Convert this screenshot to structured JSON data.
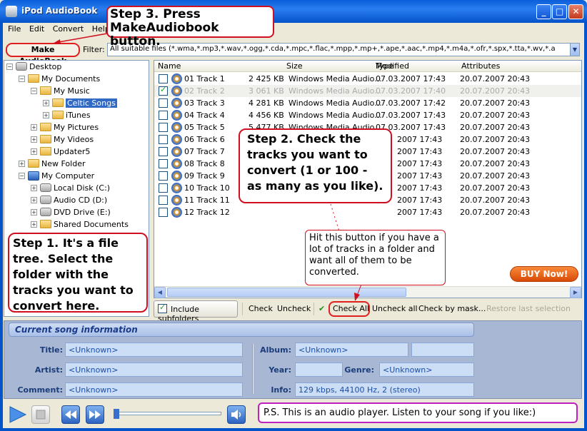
{
  "window": {
    "title": "iPod AudioBook",
    "buttons": {
      "minimize": "_",
      "maximize": "□",
      "close": "✕"
    }
  },
  "menu": [
    "File",
    "Edit",
    "Convert",
    "Help"
  ],
  "toolbar": {
    "make_button": "Make AudioBook",
    "filter_label": "Filter:",
    "filter_value": "All suitable files (*.wma,*.mp3,*.wav,*.ogg,*.cda,*.mpc,*.flac,*.mpp,*.mp+,*.ape,*.aac,*.mp4,*.m4a,*.ofr,*.spx,*.tta,*.wv,*.a"
  },
  "tree": {
    "desktop": "Desktop",
    "my_documents": "My Documents",
    "my_music": "My Music",
    "celtic_songs": "Celtic Songs",
    "itunes": "iTunes",
    "my_pictures": "My Pictures",
    "my_videos": "My Videos",
    "updater5": "Updater5",
    "new_folder": "New Folder",
    "my_computer": "My Computer",
    "local_disk": "Local Disk (C:)",
    "audio_cd": "Audio CD (D:)",
    "dvd_drive": "DVD Drive (E:)",
    "shared_documents": "Shared Documents"
  },
  "list": {
    "columns": [
      "Name",
      "Size",
      "Type",
      "Modified",
      "Attributes"
    ],
    "rows": [
      {
        "name": "01 Track 1",
        "size": "2 425 KB",
        "type": "Windows Media Audio...",
        "modified": "07.03.2007 17:43",
        "attributes": "20.07.2007 20:43",
        "checked": false
      },
      {
        "name": "02 Track 2",
        "size": "3 061 KB",
        "type": "Windows Media Audio...",
        "modified": "07.03.2007 17:40",
        "attributes": "20.07.2007 20:43",
        "checked": true
      },
      {
        "name": "03 Track 3",
        "size": "4 281 KB",
        "type": "Windows Media Audio...",
        "modified": "07.03.2007 17:42",
        "attributes": "20.07.2007 20:43",
        "checked": false
      },
      {
        "name": "04 Track 4",
        "size": "4 456 KB",
        "type": "Windows Media Audio...",
        "modified": "07.03.2007 17:43",
        "attributes": "20.07.2007 20:43",
        "checked": false
      },
      {
        "name": "05 Track 5",
        "size": "5 477 KB",
        "type": "Windows Media Audio...",
        "modified": "07.03.2007 17:43",
        "attributes": "20.07.2007 20:43",
        "checked": false
      },
      {
        "name": "06 Track 6",
        "size": "",
        "type": "",
        "modified": "2007 17:43",
        "attributes": "20.07.2007 20:43",
        "checked": false
      },
      {
        "name": "07 Track 7",
        "size": "",
        "type": "",
        "modified": "2007 17:43",
        "attributes": "20.07.2007 20:43",
        "checked": false
      },
      {
        "name": "08 Track 8",
        "size": "",
        "type": "",
        "modified": "2007 17:43",
        "attributes": "20.07.2007 20:43",
        "checked": false
      },
      {
        "name": "09 Track 9",
        "size": "",
        "type": "",
        "modified": "2007 17:43",
        "attributes": "20.07.2007 20:43",
        "checked": false
      },
      {
        "name": "10 Track 10",
        "size": "",
        "type": "",
        "modified": "2007 17:43",
        "attributes": "20.07.2007 20:43",
        "checked": false
      },
      {
        "name": "11 Track 11",
        "size": "",
        "type": "",
        "modified": "2007 17:43",
        "attributes": "20.07.2007 20:43",
        "checked": false
      },
      {
        "name": "12 Track 12",
        "size": "",
        "type": "",
        "modified": "2007 17:43",
        "attributes": "20.07.2007 20:43",
        "checked": false
      }
    ]
  },
  "buy_button": "BUY Now!",
  "actions": {
    "include_subfolders": "Include subfolders",
    "check": "Check",
    "uncheck": "Uncheck",
    "check_all": "Check All",
    "uncheck_all": "Uncheck all",
    "check_by_mask": "Check by mask...",
    "restore": "Restore last selection"
  },
  "song_info": {
    "header": "Current song information",
    "labels": {
      "title": "Title:",
      "artist": "Artist:",
      "comment": "Comment:",
      "album": "Album:",
      "year": "Year:",
      "genre": "Genre:",
      "info": "Info:"
    },
    "values": {
      "title": "<Unknown>",
      "artist": "<Unknown>",
      "comment": "<Unknown>",
      "album": "<Unknown>",
      "year": "",
      "genre": "<Unknown>",
      "info": "129 kbps, 44100 Hz, 2 (stereo)"
    }
  },
  "player": {
    "progress": 0
  },
  "callouts": {
    "step1": "Step 1. It's a file tree. Select the folder with the tracks you want to convert here.",
    "step2": "Step 2. Check the tracks you want to convert (1 or 100 - as many as you like).",
    "step3": "Step 3. Press MakeAudiobook button.",
    "hint": "Hit this button if you have a lot of tracks in a folder and want all of them to be converted.",
    "ps": "P.S. This is an audio player. Listen to your song if you like:)"
  },
  "colors": {
    "accent": "#316ac5",
    "callout_border": "#d01020",
    "ps_border": "#c020c0",
    "buy": "#e8620f"
  }
}
